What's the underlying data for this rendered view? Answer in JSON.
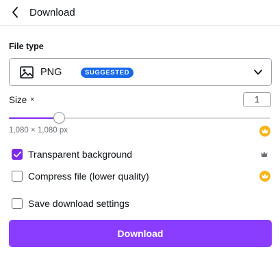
{
  "header": {
    "title": "Download",
    "back_icon": "chevron-left-icon"
  },
  "file_type": {
    "label": "File type",
    "selected": "PNG",
    "badge": "SUGGESTED",
    "icon": "image-icon",
    "badge_color": "#1769e8"
  },
  "size": {
    "label": "Size",
    "multiplier_symbol": "×",
    "value": "1",
    "dimensions": "1,080 × 1,080 px",
    "slider_fraction": 0.19
  },
  "options": [
    {
      "label": "Transparent background",
      "checked": true,
      "badge_icon": "crown-grey-icon"
    },
    {
      "label": "Compress file (lower quality)",
      "checked": false,
      "badge_icon": "crown-gold-icon"
    },
    {
      "label": "Save download settings",
      "checked": false
    }
  ],
  "download_button": {
    "label": "Download",
    "color": "#8b3dff"
  },
  "colors": {
    "accent": "#7d2ae8",
    "pro_gold": "#f6b518"
  }
}
